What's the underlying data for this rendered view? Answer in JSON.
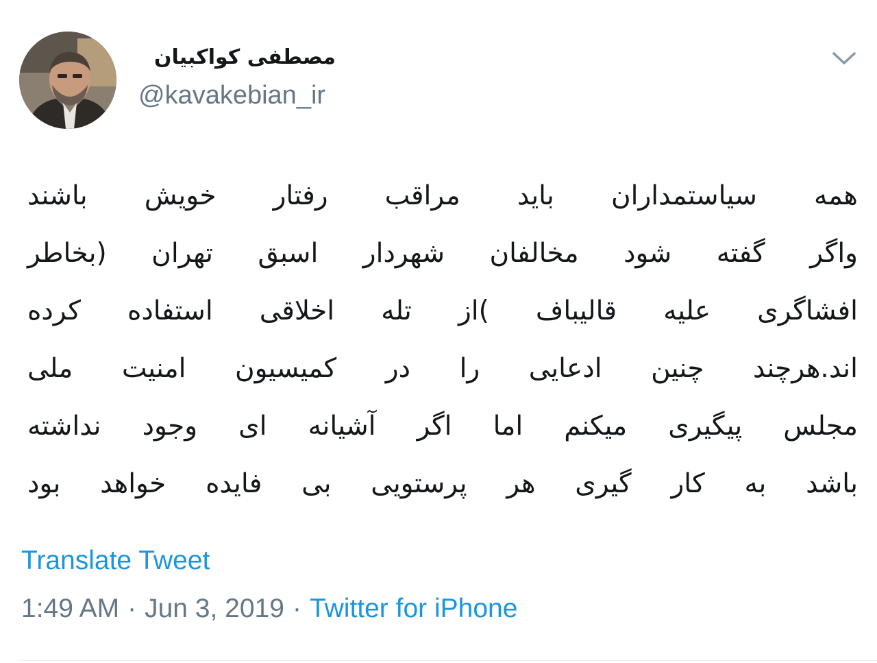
{
  "author": {
    "name": "مصطفی کواکبیان",
    "handle": "@kavakebian_ir"
  },
  "tweet": {
    "lines": [
      "همه سیاستمداران باید مراقب رفتار خویش باشند",
      "واگر گفته شود مخالفان شهردار اسبق تهران (بخاطر",
      "افشاگری علیه قالیباف )از تله اخلاقی استفاده کرده",
      "اند.هرچند چنین ادعایی را در کمیسیون امنیت ملی",
      "مجلس پیگیری میکنم اما اگر آشیانه ای وجود نداشته",
      "باشد به کار گیری هر پرستویی بی فایده خواهد بود"
    ],
    "translate_label": "Translate Tweet",
    "time": "1:49 AM",
    "date": "Jun 3, 2019",
    "separator": "·",
    "source": "Twitter for iPhone"
  },
  "icons": {
    "menu": "chevron-down-icon",
    "avatar": "avatar-photo"
  },
  "colors": {
    "text": "#14171a",
    "secondary": "#657786",
    "link": "#1b95e0",
    "divider": "#e6ecf0"
  }
}
